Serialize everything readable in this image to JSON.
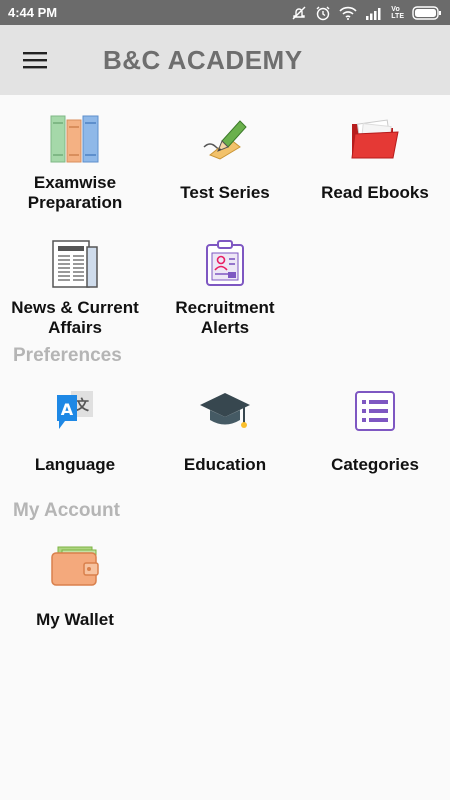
{
  "status": {
    "time": "4:44 PM",
    "network_label": "LTE",
    "carrier_label": "Vo"
  },
  "app_bar": {
    "title": "B&C ACADEMY"
  },
  "main_tiles": [
    {
      "label": "Examwise\nPreparation",
      "icon": "books-icon"
    },
    {
      "label": "Test Series",
      "icon": "pencil-writing-icon"
    },
    {
      "label": "Read Ebooks",
      "icon": "open-folder-icon"
    },
    {
      "label": "News & Current\nAffairs",
      "icon": "newspaper-icon"
    },
    {
      "label": "Recruitment\nAlerts",
      "icon": "id-clipboard-icon"
    }
  ],
  "preferences": {
    "header": "Preferences",
    "items": [
      {
        "label": "Language",
        "icon": "translate-icon"
      },
      {
        "label": "Education",
        "icon": "graduation-cap-icon"
      },
      {
        "label": "Categories",
        "icon": "list-icon"
      }
    ]
  },
  "account": {
    "header": "My Account",
    "items": [
      {
        "label": "My Wallet",
        "icon": "wallet-icon"
      }
    ]
  },
  "colors": {
    "status_bar": "#6b6b6b",
    "app_bar": "#e3e3e3",
    "title": "#6e6e6e",
    "section_header": "#b5b5b5",
    "background": "#fafafa"
  }
}
